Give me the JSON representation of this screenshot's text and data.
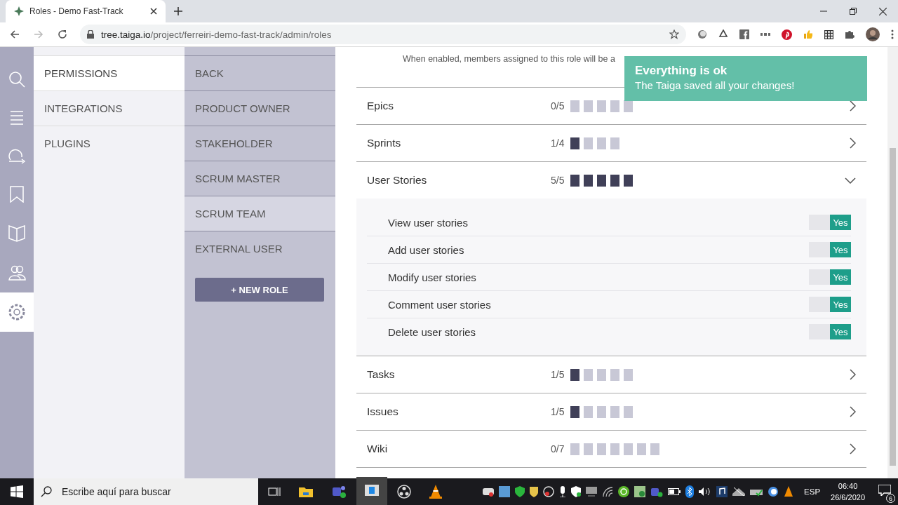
{
  "browser": {
    "tab_title": "Roles - Demo Fast-Track",
    "url_host": "tree.taiga.io",
    "url_path": "/project/ferreiri-demo-fast-track/admin/roles"
  },
  "nav_icons": [
    {
      "kind": "search",
      "selected": false
    },
    {
      "kind": "menu",
      "selected": false
    },
    {
      "kind": "loop",
      "selected": false
    },
    {
      "kind": "bookmark",
      "selected": false
    },
    {
      "kind": "book",
      "selected": false
    },
    {
      "kind": "people",
      "selected": false
    },
    {
      "kind": "settings",
      "selected": true
    }
  ],
  "admin_menu": [
    {
      "label": "PERMISSIONS",
      "selected": true
    },
    {
      "label": "INTEGRATIONS",
      "selected": false
    },
    {
      "label": "PLUGINS",
      "selected": false
    }
  ],
  "roles": [
    {
      "label": "BACK",
      "selected": false
    },
    {
      "label": "PRODUCT OWNER",
      "selected": false
    },
    {
      "label": "STAKEHOLDER",
      "selected": false
    },
    {
      "label": "SCRUM MASTER",
      "selected": false
    },
    {
      "label": "SCRUM TEAM",
      "selected": true
    },
    {
      "label": "EXTERNAL USER",
      "selected": false
    }
  ],
  "new_role_button": "+ NEW ROLE",
  "notice": "When enabled, members assigned to this role will be a",
  "toast": {
    "title": "Everything is ok",
    "message": "The Taiga saved all your changes!"
  },
  "categories": [
    {
      "name": "Epics",
      "count": "0/5",
      "expanded": false,
      "blocks": [
        {
          "filled": false
        },
        {
          "filled": false
        },
        {
          "filled": false
        },
        {
          "filled": false
        },
        {
          "filled": false
        }
      ]
    },
    {
      "name": "Sprints",
      "count": "1/4",
      "expanded": false,
      "blocks": [
        {
          "filled": true
        },
        {
          "filled": false
        },
        {
          "filled": false
        },
        {
          "filled": false
        }
      ]
    },
    {
      "name": "User Stories",
      "count": "5/5",
      "expanded": true,
      "blocks": [
        {
          "filled": true
        },
        {
          "filled": true
        },
        {
          "filled": true
        },
        {
          "filled": true
        },
        {
          "filled": true
        }
      ],
      "permissions": [
        {
          "label": "View user stories",
          "on": true,
          "value": "Yes"
        },
        {
          "label": "Add user stories",
          "on": true,
          "value": "Yes"
        },
        {
          "label": "Modify user stories",
          "on": true,
          "value": "Yes"
        },
        {
          "label": "Comment user stories",
          "on": true,
          "value": "Yes"
        },
        {
          "label": "Delete user stories",
          "on": true,
          "value": "Yes"
        }
      ]
    },
    {
      "name": "Tasks",
      "count": "1/5",
      "expanded": false,
      "blocks": [
        {
          "filled": true
        },
        {
          "filled": false
        },
        {
          "filled": false
        },
        {
          "filled": false
        },
        {
          "filled": false
        }
      ]
    },
    {
      "name": "Issues",
      "count": "1/5",
      "expanded": false,
      "blocks": [
        {
          "filled": true
        },
        {
          "filled": false
        },
        {
          "filled": false
        },
        {
          "filled": false
        },
        {
          "filled": false
        }
      ]
    },
    {
      "name": "Wiki",
      "count": "0/7",
      "expanded": false,
      "blocks": [
        {
          "filled": false
        },
        {
          "filled": false
        },
        {
          "filled": false
        },
        {
          "filled": false
        },
        {
          "filled": false
        },
        {
          "filled": false
        },
        {
          "filled": false
        }
      ]
    }
  ],
  "taskbar": {
    "search_placeholder": "Escribe aquí para buscar",
    "language": "ESP",
    "time": "06:40",
    "date": "26/6/2020",
    "notifications": "6"
  }
}
